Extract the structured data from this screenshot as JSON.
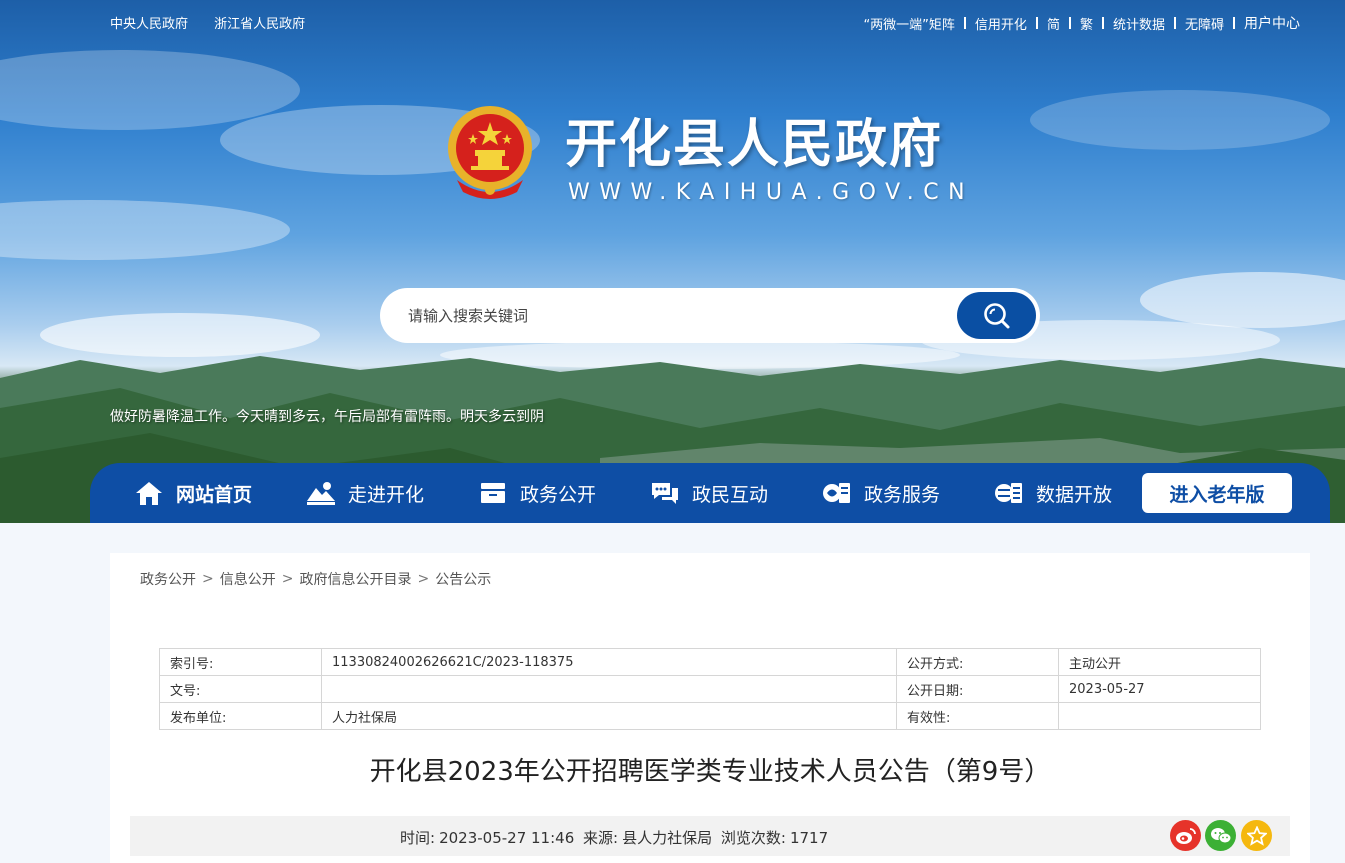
{
  "top_links": {
    "left": [
      "中央人民政府",
      "浙江省人民政府"
    ],
    "right": [
      "“两微一端”矩阵",
      "信用开化",
      "简",
      "繁",
      "统计数据",
      "无障碍",
      "用户中心"
    ]
  },
  "site": {
    "title": "开化县人民政府",
    "url": "WWW.KAIHUA.GOV.CN"
  },
  "search": {
    "placeholder": "请输入搜索关键词",
    "button_icon": "search-icon"
  },
  "weather_text": "做好防暑降温工作。今天晴到多云，午后局部有雷阵雨。明天多云到阴",
  "nav": {
    "items": [
      {
        "label": "网站首页",
        "icon": "home-icon"
      },
      {
        "label": "走进开化",
        "icon": "landscape-icon"
      },
      {
        "label": "政务公开",
        "icon": "folder-icon"
      },
      {
        "label": "政民互动",
        "icon": "chat-icon"
      },
      {
        "label": "政务服务",
        "icon": "service-icon"
      },
      {
        "label": "数据开放",
        "icon": "data-icon"
      }
    ],
    "elder_label": "进入老年版"
  },
  "breadcrumb": [
    "政务公开",
    "信息公开",
    "政府信息公开目录",
    "公告公示"
  ],
  "meta_table": {
    "index_label": "索引号:",
    "index_value": "11330824002626621C/2023-118375",
    "method_label": "公开方式:",
    "method_value": "主动公开",
    "docno_label": "文号:",
    "docno_value": "",
    "date_label": "公开日期:",
    "date_value": "2023-05-27",
    "publisher_label": "发布单位:",
    "publisher_value": "人力社保局",
    "validity_label": "有效性:",
    "validity_value": ""
  },
  "article": {
    "title": "开化县2023年公开招聘医学类专业技术人员公告（第9号）",
    "time_label": "时间:",
    "time_value": "2023-05-27 11:46",
    "source_label": "来源:",
    "source_value": "县人力社保局",
    "views_label": "浏览次数:",
    "views_value": "1717"
  },
  "share": {
    "colors": {
      "weibo": "#e6332a",
      "wechat": "#3cb035",
      "favorite": "#f5b80f"
    },
    "icons": [
      "weibo-icon",
      "wechat-icon",
      "star-icon"
    ]
  },
  "colors": {
    "nav_blue": "#0e4ea5",
    "search_button": "#0a4fa3"
  }
}
